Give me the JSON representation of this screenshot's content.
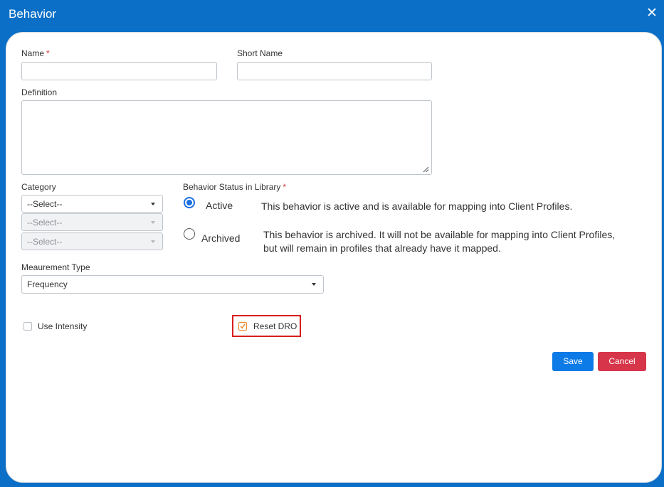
{
  "dialog": {
    "title": "Behavior",
    "close_icon": "close-icon"
  },
  "form": {
    "name_label": "Name",
    "name_required": "*",
    "name_value": "",
    "short_name_label": "Short Name",
    "short_name_value": "",
    "definition_label": "Definition",
    "definition_value": "",
    "category_label": "Category",
    "category_select_1": "--Select--",
    "category_select_2": "--Select--",
    "category_select_3": "--Select--",
    "status_label": "Behavior Status in Library",
    "status_required": "*",
    "status_options": [
      {
        "label": "Active",
        "checked": true,
        "description": "This behavior is active and is available for mapping into Client Profiles."
      },
      {
        "label": "Archived",
        "checked": false,
        "description_line1": "This behavior is archived. It will not be available for mapping into Client Profiles,",
        "description_line2": "but will remain in profiles that already have it mapped."
      }
    ],
    "measurement_label": "Meaurement Type",
    "measurement_value": "Frequency",
    "use_intensity_label": "Use Intensity",
    "use_intensity_checked": false,
    "reset_dro_label": "Reset DRO",
    "reset_dro_checked": true
  },
  "buttons": {
    "save": "Save",
    "cancel": "Cancel"
  },
  "colors": {
    "titlebar": "#0b6fc7",
    "save": "#0d7be7",
    "cancel": "#d7364a",
    "highlight": "#d81e1e",
    "required": "#e0343b"
  }
}
